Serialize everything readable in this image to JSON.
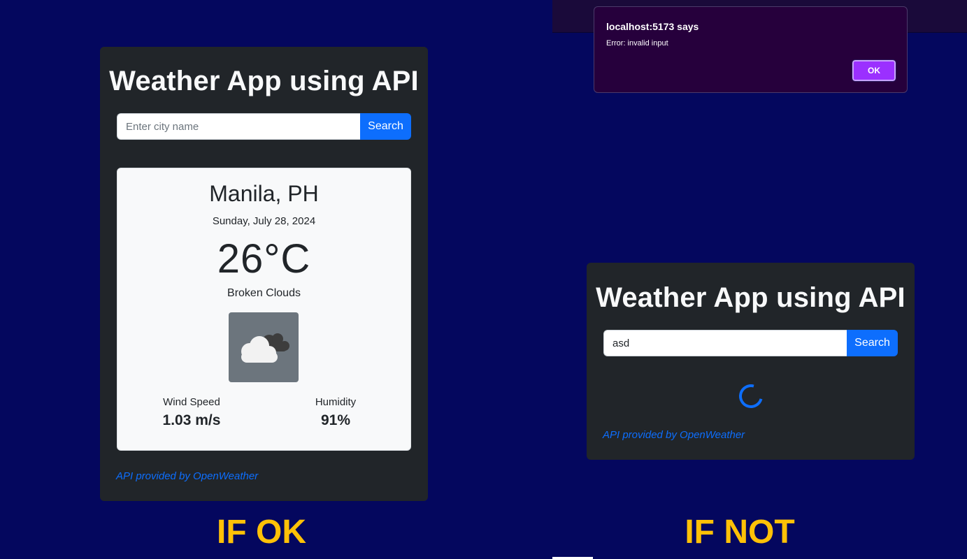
{
  "app_title": "Weather App using API",
  "search": {
    "placeholder": "Enter city name",
    "button_label": "Search"
  },
  "ok_state": {
    "city": "Manila, PH",
    "date": "Sunday, July 28, 2024",
    "temperature": "26°C",
    "description": "Broken Clouds",
    "weather_icon": "broken-clouds-icon",
    "wind_label": "Wind Speed",
    "wind_value": "1.03 m/s",
    "humidity_label": "Humidity",
    "humidity_value": "91%",
    "credit": "API provided by OpenWeather",
    "caption": "IF OK"
  },
  "error_state": {
    "input_value": "asd",
    "credit": "API provided by OpenWeather",
    "caption": "IF NOT"
  },
  "dialog": {
    "title": "localhost:5173 says",
    "message": "Error: invalid input",
    "ok_label": "OK"
  },
  "colors": {
    "background": "#04075e",
    "panel": "#212529",
    "primary": "#0d6efd",
    "caption": "#ffc107",
    "dialog_bg": "#26003c",
    "dialog_button": "#9b30ff"
  }
}
